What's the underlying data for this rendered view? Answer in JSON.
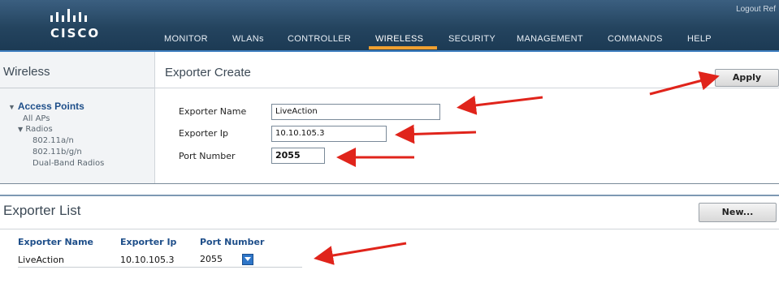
{
  "brand": {
    "name": "CISCO"
  },
  "topbar": {
    "links": "Logout  Ref"
  },
  "nav": {
    "items": [
      "MONITOR",
      "WLANs",
      "CONTROLLER",
      "WIRELESS",
      "SECURITY",
      "MANAGEMENT",
      "COMMANDS",
      "HELP"
    ],
    "active": "WIRELESS"
  },
  "sidebar": {
    "title": "Wireless",
    "section": "Access Points",
    "items": [
      "All APs",
      "Radios",
      "802.11a/n",
      "802.11b/g/n",
      "Dual-Band Radios"
    ]
  },
  "create": {
    "title": "Exporter Create",
    "apply_label": "Apply",
    "name_label": "Exporter Name",
    "name_value": "LiveAction",
    "ip_label": "Exporter Ip",
    "ip_value": "10.10.105.3",
    "port_label": "Port Number",
    "port_value": "2055"
  },
  "list": {
    "title": "Exporter List",
    "new_label": "New...",
    "columns": [
      "Exporter Name",
      "Exporter Ip",
      "Port Number"
    ],
    "rows": [
      {
        "name": "LiveAction",
        "ip": "10.10.105.3",
        "port": "2055"
      }
    ]
  },
  "colors": {
    "accent": "#f0a030",
    "navbar": "#24445f",
    "link": "#1f4f8a",
    "arrow": "#e0241b"
  }
}
